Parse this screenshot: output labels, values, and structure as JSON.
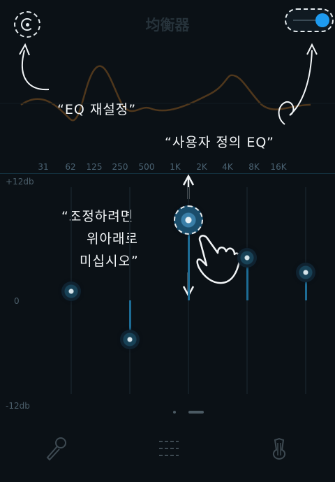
{
  "header": {
    "title": "均衡器",
    "reset_icon": "reset-icon",
    "toggle_icon": "toggle-switch-icon",
    "accent_color": "#1e9bf0"
  },
  "tutorial": {
    "reset_note": "“EQ 재설정”",
    "custom_note": "“사용자 정의 EQ”",
    "drag_note_line1": "“조정하려면",
    "drag_note_line2": "위아래로",
    "drag_note_line3": "미십시오”"
  },
  "bands": {
    "labels": [
      "31",
      "62",
      "125",
      "250",
      "500",
      "1K",
      "2K",
      "4K",
      "8K",
      "16K"
    ]
  },
  "scale": {
    "top": "+12db",
    "mid": "0",
    "bottom": "-12db"
  },
  "visible_sliders": [
    {
      "band": "62",
      "value_db": 1
    },
    {
      "band": "250",
      "value_db": -4.5
    },
    {
      "band": "1K",
      "value_db": 8.5
    },
    {
      "band": "8K",
      "value_db": 4.5
    },
    {
      "band": "16K",
      "value_db": 3
    }
  ],
  "bottom_nav": {
    "mic_icon": "microphone-icon",
    "eq_icon": "equalizer-sliders-icon",
    "guitar_icon": "guitar-icon"
  }
}
